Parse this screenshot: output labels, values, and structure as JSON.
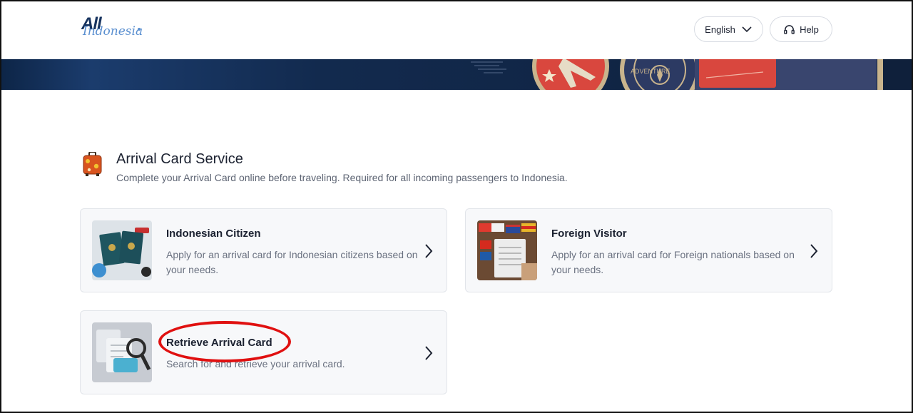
{
  "logo": {
    "primary": "All",
    "secondary": "Indonesia"
  },
  "header": {
    "language_label": "English",
    "help_label": "Help"
  },
  "section": {
    "title": "Arrival Card Service",
    "description": "Complete your Arrival Card online before traveling. Required for all incoming passengers to Indonesia."
  },
  "cards": [
    {
      "title": "Indonesian Citizen",
      "description": "Apply for an arrival card for Indonesian citizens based on your needs."
    },
    {
      "title": "Foreign Visitor",
      "description": "Apply for an arrival card for Foreign nationals based on your needs."
    },
    {
      "title": "Retrieve Arrival Card",
      "description": "Search for and retrieve your arrival card."
    }
  ],
  "icons": {
    "language_dropdown": "chevron-down-icon",
    "help": "headset-icon",
    "section": "suitcase-icon",
    "card_action": "chevron-right-icon"
  },
  "colors": {
    "annotation": "#e01010",
    "brand_navy": "#17335f",
    "banner_red": "#d9473e"
  }
}
